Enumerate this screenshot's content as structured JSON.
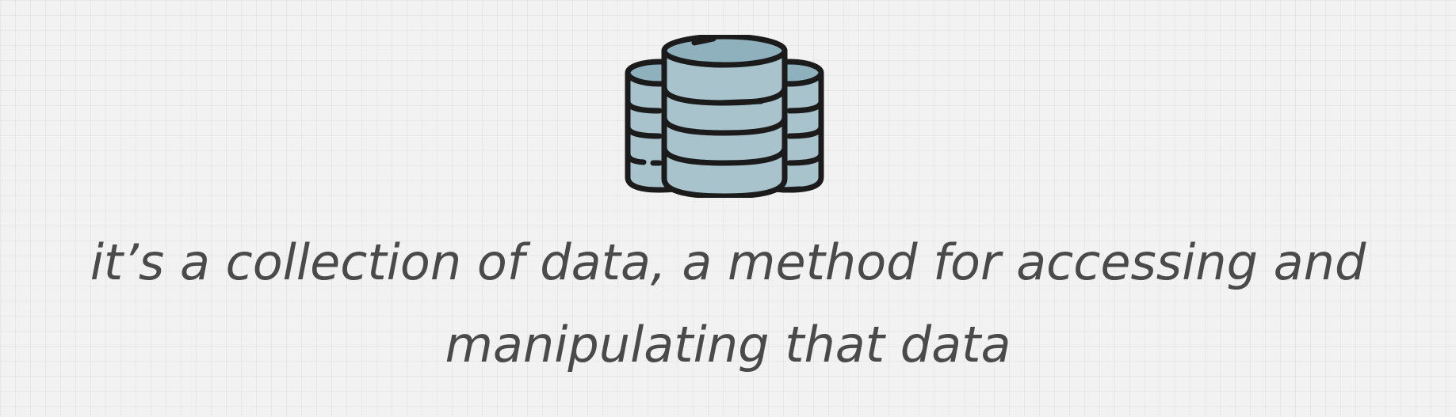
{
  "slide": {
    "icon": "database-icon",
    "caption_line1": "it’s a collection of data, a method for accessing and",
    "caption_line2": "manipulating that data"
  },
  "colors": {
    "background": "#f2f2f2",
    "text": "#4a4a4a",
    "icon_fill": "#a9c3cd",
    "icon_shade": "#8fb0bd",
    "icon_outline": "#1b1b1b"
  }
}
